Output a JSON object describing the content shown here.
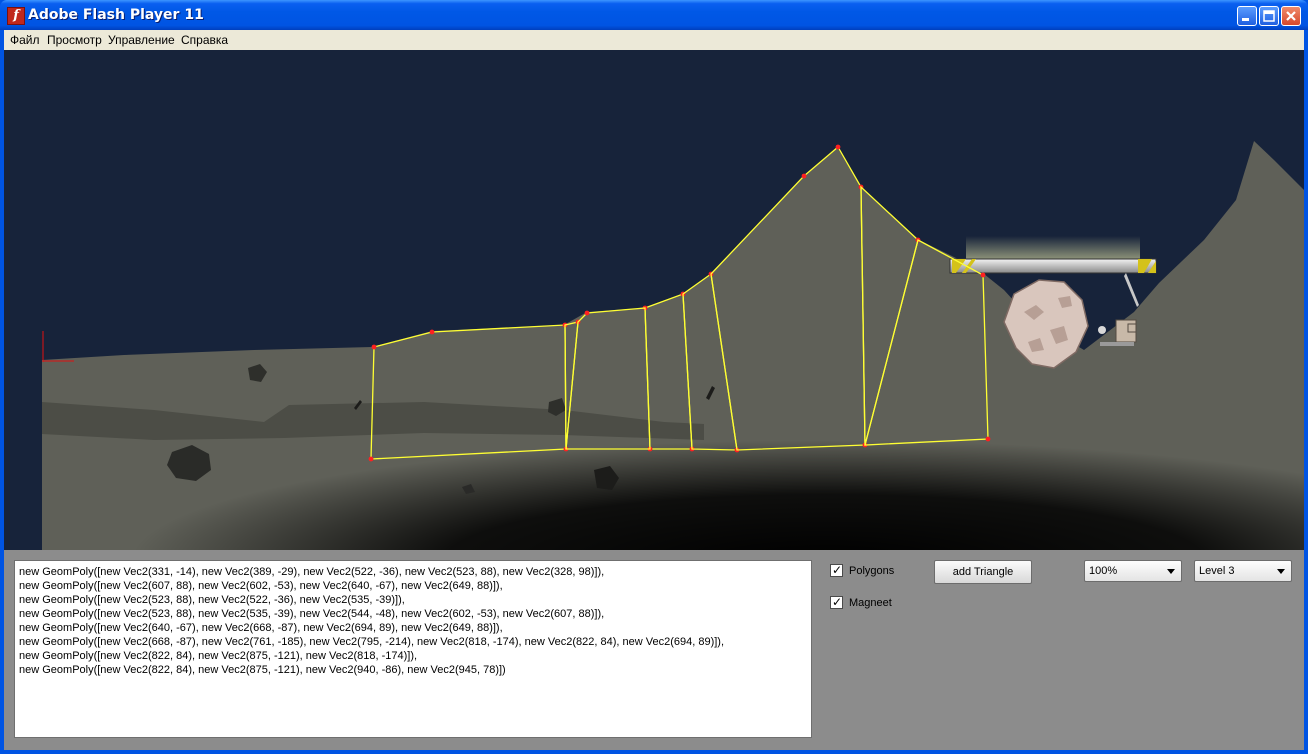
{
  "window": {
    "title": "Adobe Flash Player 11",
    "icon": "flash-icon",
    "controls": [
      "minimize-icon",
      "maximize-icon",
      "close-icon"
    ]
  },
  "menu": {
    "items": [
      "Файл",
      "Просмотр",
      "Управление",
      "Справка"
    ]
  },
  "code": {
    "lines": [
      "new GeomPoly([new Vec2(331, -14), new Vec2(389, -29), new Vec2(522, -36), new Vec2(523, 88), new Vec2(328, 98)]),",
      "new GeomPoly([new Vec2(607, 88), new Vec2(602, -53), new Vec2(640, -67), new Vec2(649, 88)]),",
      "new GeomPoly([new Vec2(523, 88), new Vec2(522, -36), new Vec2(535, -39)]),",
      "new GeomPoly([new Vec2(523, 88), new Vec2(535, -39), new Vec2(544, -48), new Vec2(602, -53), new Vec2(607, 88)]),",
      "new GeomPoly([new Vec2(640, -67), new Vec2(668, -87), new Vec2(694, 89), new Vec2(649, 88)]),",
      "new GeomPoly([new Vec2(668, -87), new Vec2(761, -185), new Vec2(795, -214), new Vec2(818, -174), new Vec2(822, 84), new Vec2(694, 89)]),",
      "new GeomPoly([new Vec2(822, 84), new Vec2(875, -121), new Vec2(818, -174)]),",
      "new GeomPoly([new Vec2(822, 84), new Vec2(875, -121), new Vec2(940, -86), new Vec2(945, 78)])"
    ]
  },
  "controls": {
    "polygons_label": "Polygons",
    "polygons_checked": true,
    "magneet_label": "Magneet",
    "magneet_checked": true,
    "add_triangle_label": "add Triangle",
    "zoom_value": "100%",
    "level_value": "Level 3"
  },
  "colors": {
    "sky": "#17233a",
    "ground": "#5f6058",
    "polygon_edge": "#ffff33",
    "vertex": "#ff2020",
    "panel": "#8c8c8c"
  }
}
